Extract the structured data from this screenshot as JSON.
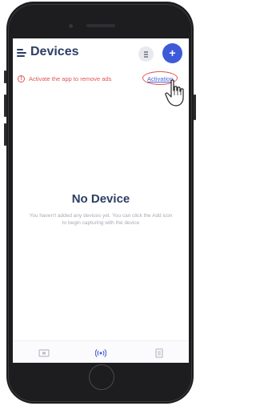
{
  "header": {
    "title": "Devices",
    "menu_icon": "menu-icon",
    "filter_icon": "filter-icon",
    "add_label": "+"
  },
  "banner": {
    "icon": "info-circle-icon",
    "icon_glyph": "!",
    "message": "Activate the app to remove ads",
    "link_label": "Activation",
    "annotation": "hand-pointer-icon"
  },
  "empty_state": {
    "title": "No Device",
    "message": "You haven't added any devices yet. You can click the Add icon to begin capturing with the device"
  },
  "bottom_nav": {
    "items": [
      {
        "icon": "screen-icon",
        "active": false
      },
      {
        "icon": "broadcast-icon",
        "active": true
      },
      {
        "icon": "document-icon",
        "active": false
      }
    ]
  },
  "colors": {
    "brand": "#2c3e66",
    "accent": "#3d5bd9",
    "warning": "#e05555",
    "muted": "#a8abb3"
  }
}
